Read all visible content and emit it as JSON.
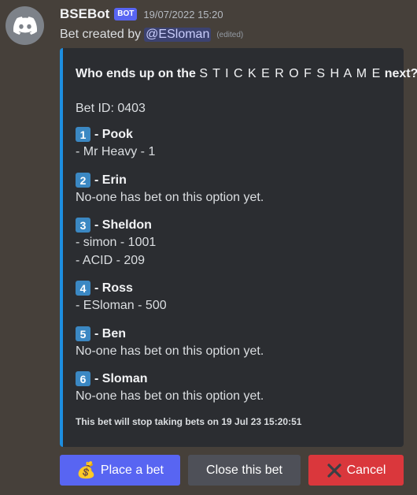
{
  "message": {
    "username": "BSEBot",
    "bot_tag": "BOT",
    "timestamp": "19/07/2022 15:20",
    "content_prefix": "Bet created by",
    "mention": "@ESloman",
    "edited_label": "(edited)"
  },
  "embed": {
    "title_start": "Who ends up on the",
    "title_spaced": "S T I C K E R O F S H A M E",
    "title_end": "next?",
    "bet_id": "Bet ID: 0403",
    "accent_color": "#1d8ee0",
    "options": [
      {
        "number": "1",
        "name": "- Pook",
        "lines": [
          "- Mr Heavy - 1"
        ]
      },
      {
        "number": "2",
        "name": "- Erin",
        "lines": [
          "No-one has bet on this option yet."
        ]
      },
      {
        "number": "3",
        "name": "- Sheldon",
        "lines": [
          "- simon - 1001",
          "- ACID - 209"
        ]
      },
      {
        "number": "4",
        "name": "- Ross",
        "lines": [
          "- ESloman - 500"
        ]
      },
      {
        "number": "5",
        "name": "- Ben",
        "lines": [
          "No-one has bet on this option yet."
        ]
      },
      {
        "number": "6",
        "name": "- Sloman",
        "lines": [
          "No-one has bet on this option yet."
        ]
      }
    ],
    "footer": "This bet will stop taking bets on 19 Jul 23 15:20:51"
  },
  "buttons": {
    "place_label": "Place a bet",
    "place_icon": "money-bag-icon",
    "close_label": "Close this bet",
    "cancel_label": "Cancel",
    "cancel_icon": "x-icon"
  },
  "colors": {
    "blurple": "#5865f2",
    "secondary": "#4e5058",
    "danger": "#da373c"
  }
}
